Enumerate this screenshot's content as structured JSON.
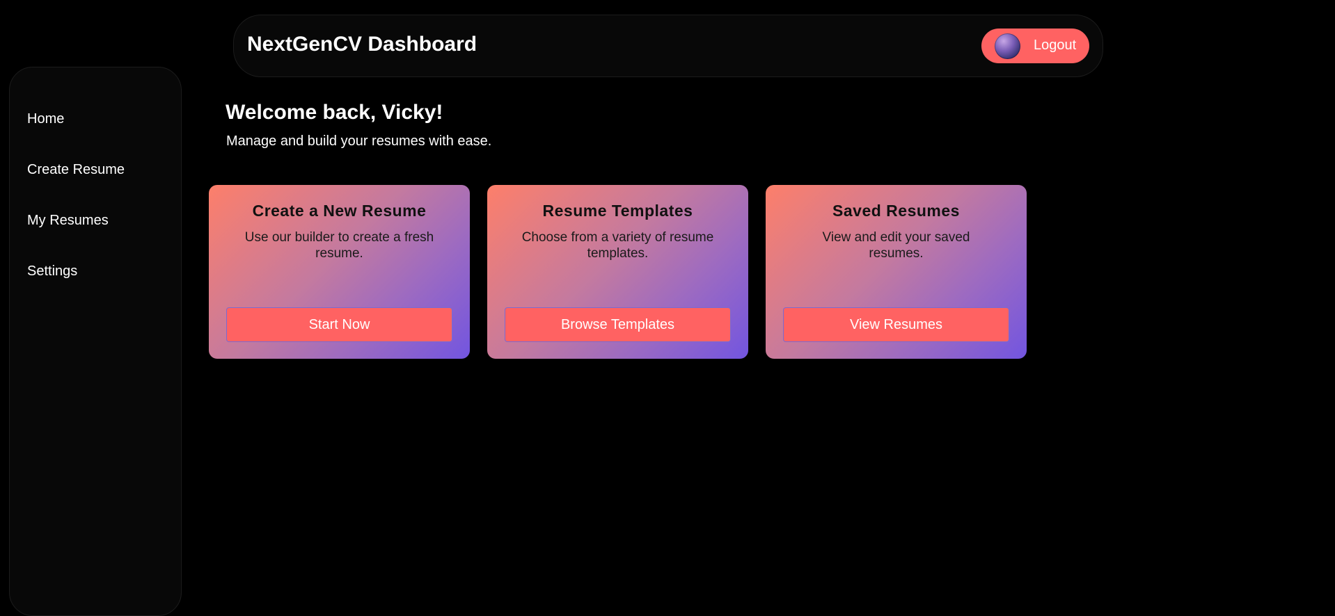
{
  "header": {
    "title": "NextGenCV Dashboard",
    "logout_label": "Logout"
  },
  "sidebar": {
    "items": [
      {
        "label": "Home"
      },
      {
        "label": "Create Resume"
      },
      {
        "label": "My Resumes"
      },
      {
        "label": "Settings"
      }
    ]
  },
  "welcome": {
    "title": "Welcome back, Vicky!",
    "subtitle": "Manage and build your resumes with ease."
  },
  "cards": [
    {
      "title": "Create a New Resume",
      "description": "Use our builder to create a fresh resume.",
      "button_label": "Start Now"
    },
    {
      "title": "Resume Templates",
      "description": "Choose from a variety of resume templates.",
      "button_label": "Browse Templates"
    },
    {
      "title": "Saved Resumes",
      "description": "View and edit your saved resumes.",
      "button_label": "View Resumes"
    }
  ],
  "colors": {
    "background": "#000000",
    "panel": "#080808",
    "accent": "#ff6262",
    "card_gradient_start": "#fd7f6a",
    "card_gradient_end": "#7255e0"
  }
}
